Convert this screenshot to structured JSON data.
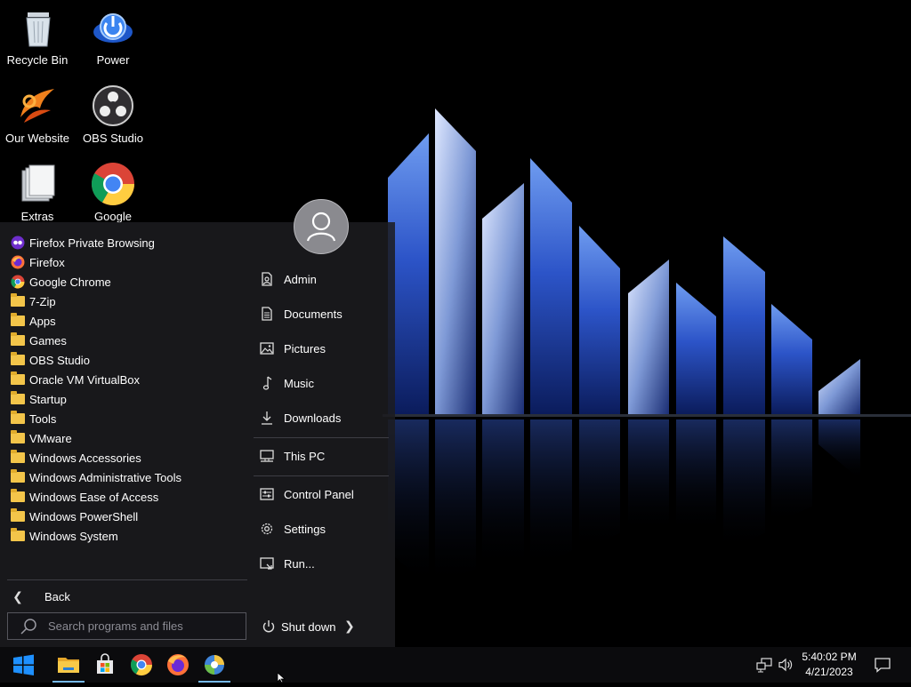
{
  "desktop": {
    "icons": [
      {
        "label": "Recycle Bin",
        "icon": "recycle-bin-icon"
      },
      {
        "label": "Power",
        "icon": "power-icon"
      },
      {
        "label": "Our Website",
        "icon": "website-icon"
      },
      {
        "label": "OBS Studio",
        "icon": "obs-studio-icon"
      },
      {
        "label": "Extras",
        "icon": "extras-icon"
      },
      {
        "label": "Google",
        "icon": "chrome-icon"
      }
    ]
  },
  "start_menu": {
    "programs": [
      {
        "label": "Firefox Private Browsing",
        "icon": "firefox-private-icon"
      },
      {
        "label": "Firefox",
        "icon": "firefox-icon"
      },
      {
        "label": "Google Chrome",
        "icon": "chrome-icon"
      },
      {
        "label": "7-Zip",
        "icon": "folder-icon"
      },
      {
        "label": "Apps",
        "icon": "folder-icon"
      },
      {
        "label": "Games",
        "icon": "folder-icon"
      },
      {
        "label": "OBS Studio",
        "icon": "folder-icon"
      },
      {
        "label": "Oracle VM VirtualBox",
        "icon": "folder-icon"
      },
      {
        "label": "Startup",
        "icon": "folder-icon"
      },
      {
        "label": "Tools",
        "icon": "folder-icon"
      },
      {
        "label": "VMware",
        "icon": "folder-icon"
      },
      {
        "label": "Windows Accessories",
        "icon": "folder-icon"
      },
      {
        "label": "Windows Administrative Tools",
        "icon": "folder-icon"
      },
      {
        "label": "Windows Ease of Access",
        "icon": "folder-icon"
      },
      {
        "label": "Windows PowerShell",
        "icon": "folder-icon"
      },
      {
        "label": "Windows System",
        "icon": "folder-icon"
      }
    ],
    "back_label": "Back",
    "search_placeholder": "Search programs and files",
    "places": [
      {
        "label": "Admin",
        "icon": "user-doc-icon"
      },
      {
        "label": "Documents",
        "icon": "documents-icon"
      },
      {
        "label": "Pictures",
        "icon": "pictures-icon"
      },
      {
        "label": "Music",
        "icon": "music-icon"
      },
      {
        "label": "Downloads",
        "icon": "downloads-icon"
      },
      {
        "label": "This PC",
        "icon": "computer-icon"
      },
      {
        "label": "Control Panel",
        "icon": "control-panel-icon"
      },
      {
        "label": "Settings",
        "icon": "gear-icon"
      },
      {
        "label": "Run...",
        "icon": "run-icon"
      }
    ],
    "shutdown_label": "Shut down"
  },
  "taskbar": {
    "buttons": [
      {
        "name": "start",
        "icon": "windows-logo-icon"
      },
      {
        "name": "file-explorer",
        "icon": "folder-icon"
      },
      {
        "name": "store",
        "icon": "store-icon"
      },
      {
        "name": "chrome",
        "icon": "chrome-icon"
      },
      {
        "name": "firefox",
        "icon": "firefox-icon"
      },
      {
        "name": "open-app",
        "icon": "app-icon"
      }
    ],
    "time": "5:40:02 PM",
    "date": "4/21/2023"
  },
  "colors": {
    "accent": "#76b9ed",
    "folder": "#f3c54a",
    "menu_bg": "#1c1c20"
  }
}
